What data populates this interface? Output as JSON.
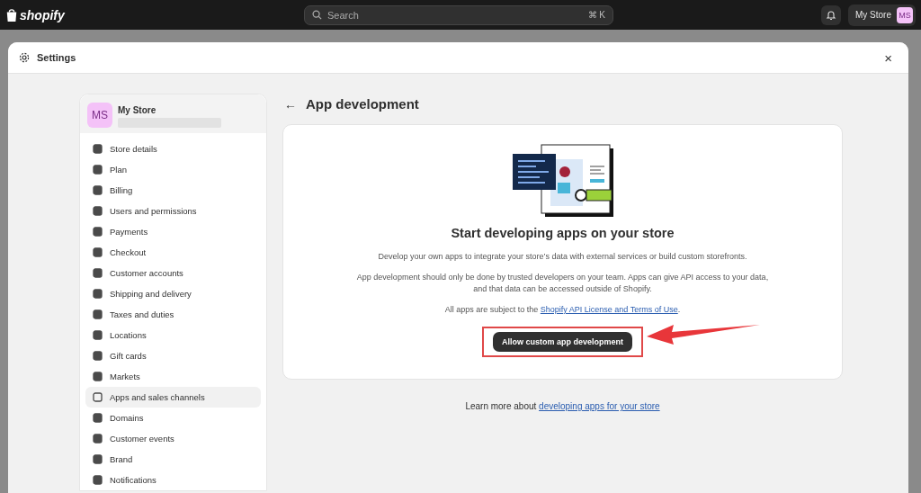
{
  "topbar": {
    "logo": "shopify",
    "search": {
      "placeholder": "Search",
      "shortcut": "⌘ K"
    },
    "store_name": "My Store",
    "avatar": "MS"
  },
  "modal": {
    "title": "Settings",
    "close": "×"
  },
  "sidebar": {
    "store": {
      "avatar": "MS",
      "name": "My Store"
    },
    "items": [
      {
        "label": "Store details",
        "selected": false
      },
      {
        "label": "Plan",
        "selected": false
      },
      {
        "label": "Billing",
        "selected": false
      },
      {
        "label": "Users and permissions",
        "selected": false
      },
      {
        "label": "Payments",
        "selected": false
      },
      {
        "label": "Checkout",
        "selected": false
      },
      {
        "label": "Customer accounts",
        "selected": false
      },
      {
        "label": "Shipping and delivery",
        "selected": false
      },
      {
        "label": "Taxes and duties",
        "selected": false
      },
      {
        "label": "Locations",
        "selected": false
      },
      {
        "label": "Gift cards",
        "selected": false
      },
      {
        "label": "Markets",
        "selected": false
      },
      {
        "label": "Apps and sales channels",
        "selected": true
      },
      {
        "label": "Domains",
        "selected": false
      },
      {
        "label": "Customer events",
        "selected": false
      },
      {
        "label": "Brand",
        "selected": false
      },
      {
        "label": "Notifications",
        "selected": false
      }
    ]
  },
  "page": {
    "back": "←",
    "title": "App development",
    "card": {
      "heading": "Start developing apps on your store",
      "paragraphs": [
        "Develop your own apps to integrate your store’s data with external services or build custom storefronts.",
        "App development should only be done by trusted developers on your team. Apps can give API access to your data, and that data can be accessed outside of Shopify."
      ],
      "terms_prefix": "All apps are subject to the ",
      "terms_link": "Shopify API License and Terms of Use",
      "terms_suffix": ".",
      "button": "Allow custom app development",
      "highlighted": true
    },
    "footer": {
      "prefix": "Learn more about ",
      "link": "developing apps for your store"
    }
  }
}
